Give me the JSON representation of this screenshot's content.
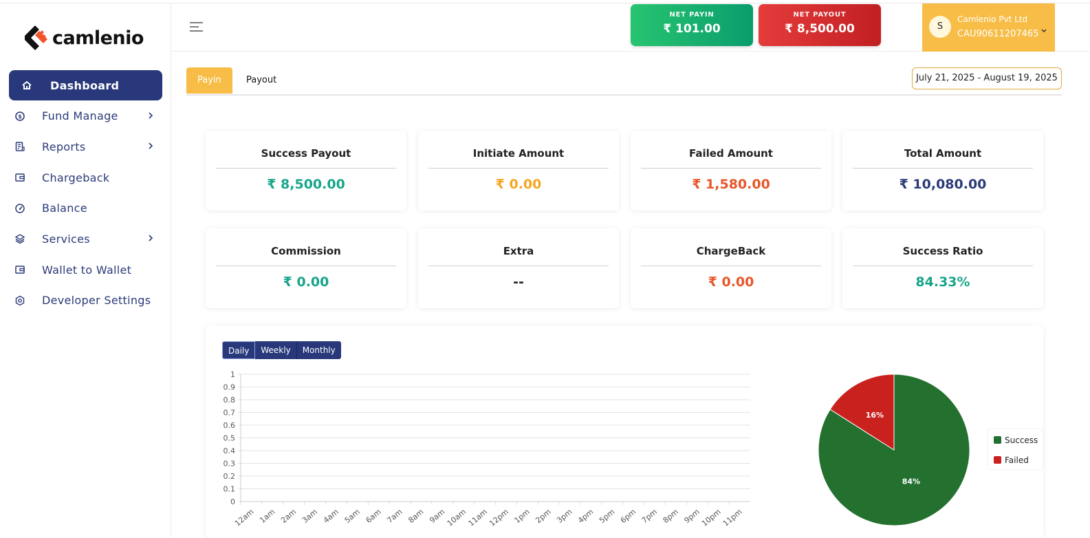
{
  "brand": {
    "name": "camlenio"
  },
  "sidebar": {
    "items": [
      {
        "label": "Dashboard",
        "icon": "home-icon",
        "active": true,
        "has_submenu": false
      },
      {
        "label": "Fund Manage",
        "icon": "dollar-circle-icon",
        "active": false,
        "has_submenu": true
      },
      {
        "label": "Reports",
        "icon": "report-icon",
        "active": false,
        "has_submenu": true
      },
      {
        "label": "Chargeback",
        "icon": "wallet-icon",
        "active": false,
        "has_submenu": false
      },
      {
        "label": "Balance",
        "icon": "gauge-icon",
        "active": false,
        "has_submenu": false
      },
      {
        "label": "Services",
        "icon": "layers-icon",
        "active": false,
        "has_submenu": true
      },
      {
        "label": "Wallet to Wallet",
        "icon": "wallet-icon",
        "active": false,
        "has_submenu": false
      },
      {
        "label": "Developer Settings",
        "icon": "hexagon-gear-icon",
        "active": false,
        "has_submenu": false
      }
    ]
  },
  "header": {
    "net_payin": {
      "label": "NET PAYIN",
      "value": "₹ 101.00"
    },
    "net_payout": {
      "label": "NET PAYOUT",
      "value": "₹ 8,500.00"
    },
    "user": {
      "initial": "S",
      "name": "Camlenio Pvt Ltd",
      "id": "CAU9061120​7465"
    }
  },
  "tabs": {
    "payin": "Payin",
    "payout": "Payout",
    "date_range": "July 21, 2025 - August 19, 2025"
  },
  "stats": [
    {
      "title": "Success Payout",
      "value": "₹ 8,500.00",
      "color": "green"
    },
    {
      "title": "Initiate Amount",
      "value": "₹ 0.00",
      "color": "orange"
    },
    {
      "title": "Failed Amount",
      "value": "₹ 1,580.00",
      "color": "red"
    },
    {
      "title": "Total Amount",
      "value": "₹ 10,080.00",
      "color": "navy"
    },
    {
      "title": "Commission",
      "value": "₹ 0.00",
      "color": "green"
    },
    {
      "title": "Extra",
      "value": "--",
      "color": "black"
    },
    {
      "title": "ChargeBack",
      "value": "₹ 0.00",
      "color": "red"
    },
    {
      "title": "Success Ratio",
      "value": "84.33%",
      "color": "green"
    }
  ],
  "period_buttons": {
    "daily": "Daily",
    "weekly": "Weekly",
    "monthly": "Monthly"
  },
  "chart_data": [
    {
      "type": "line",
      "x": [
        "12am",
        "1am",
        "2am",
        "3am",
        "4am",
        "5am",
        "6am",
        "7am",
        "8am",
        "9am",
        "10am",
        "11am",
        "12pm",
        "1pm",
        "2pm",
        "3pm",
        "4pm",
        "5pm",
        "6pm",
        "7pm",
        "8pm",
        "9pm",
        "10pm",
        "11pm"
      ],
      "series": [],
      "y_ticks": [
        "0",
        "0.1",
        "0.2",
        "0.3",
        "0.4",
        "0.5",
        "0.6",
        "0.7",
        "0.8",
        "0.9",
        "1"
      ],
      "ylim": [
        0,
        1
      ],
      "grid": true
    },
    {
      "type": "pie",
      "slices": [
        {
          "name": "Success",
          "value": 84,
          "label": "84%",
          "color": "#23702f"
        },
        {
          "name": "Failed",
          "value": 16,
          "label": "16%",
          "color": "#c9211e"
        }
      ],
      "legend": "right"
    }
  ]
}
